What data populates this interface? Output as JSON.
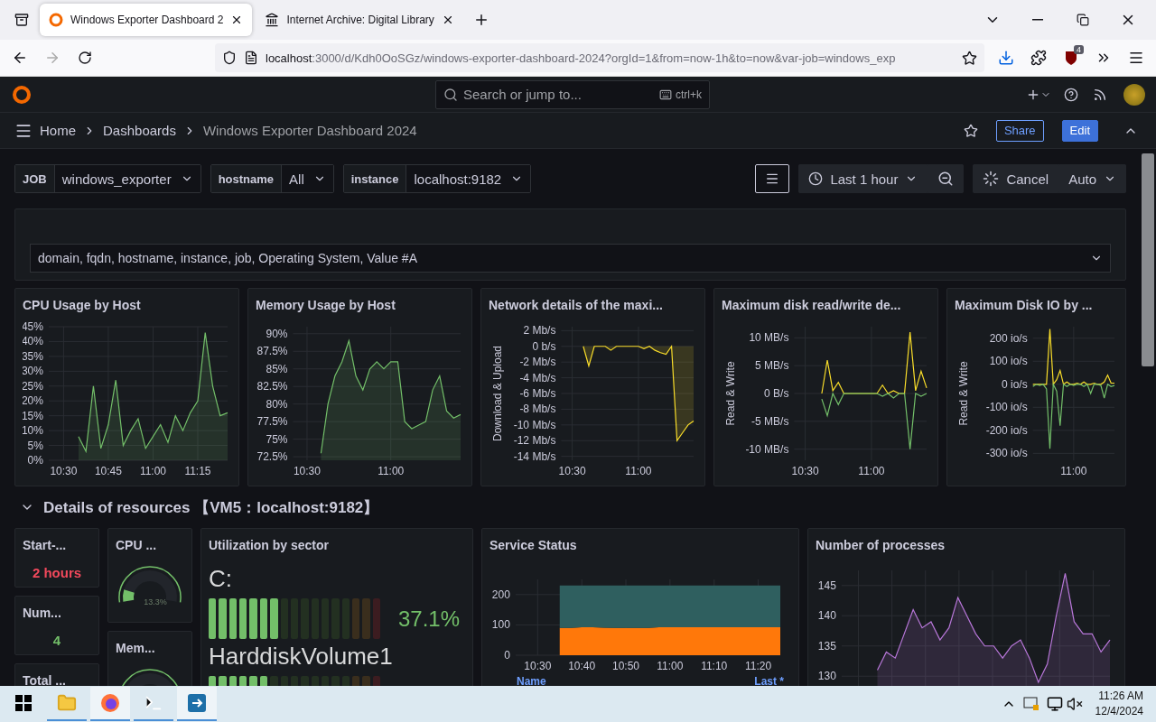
{
  "browser": {
    "tabs": [
      {
        "title": "Windows Exporter Dashboard 2",
        "selected": true
      },
      {
        "title": "Internet Archive: Digital Library",
        "selected": false
      }
    ],
    "address": {
      "host": "localhost",
      "path": ":3000/d/Kdh0OoSGz/windows-exporter-dashboard-2024?orgId=1&from=now-1h&to=now&var-job=windows_exp"
    },
    "extension_badge": "4"
  },
  "topbar": {
    "search_placeholder": "Search or jump to...",
    "shortcut": "ctrl+k"
  },
  "breadcrumbs": [
    "Home",
    "Dashboards",
    "Windows Exporter Dashboard 2024"
  ],
  "actions": [
    {
      "label": "Share",
      "kind": "secondary"
    },
    {
      "label": "Edit",
      "kind": "primary"
    }
  ],
  "variables": [
    {
      "label": "JOB",
      "value": "windows_exporter"
    },
    {
      "label": "hostname",
      "value": "All"
    },
    {
      "label": "instance",
      "value": "localhost:9182"
    }
  ],
  "time_range": "Last 1 hour",
  "cancel": "Cancel",
  "refresh": "Auto",
  "filter_select": {
    "value": "domain, fqdn, hostname, instance, job, Operating System, Value #A"
  },
  "panels": [
    {
      "title": "CPU Usage by Host",
      "chart_data": {
        "type": "area",
        "grid": true,
        "ylim": [
          0,
          45
        ],
        "categories": [
          null,
          null,
          "10:30",
          null,
          null,
          null,
          null,
          null,
          "10:45",
          null,
          null,
          null,
          null,
          null,
          "11:00",
          null,
          null,
          null,
          null,
          null,
          "11:15",
          null,
          null,
          null,
          null
        ],
        "yticks": [
          {
            "value": 45,
            "label": "45%"
          },
          {
            "value": 40,
            "label": "40%"
          },
          {
            "value": 35,
            "label": "35%"
          },
          {
            "value": 30,
            "label": "30%"
          },
          {
            "value": 25,
            "label": "25%"
          },
          {
            "value": 20,
            "label": "20%"
          },
          {
            "value": 15,
            "label": "15%"
          },
          {
            "value": 10,
            "label": "10%"
          },
          {
            "value": 5,
            "label": "5%"
          },
          {
            "value": 0,
            "label": "0%"
          }
        ],
        "series": [
          {
            "color": "#73bf69",
            "values": [
              null,
              null,
              null,
              null,
              8,
              3,
              25,
              4,
              12,
              27,
              5,
              10,
              14,
              4,
              8,
              12,
              6,
              15,
              10,
              16,
              20,
              43,
              25,
              15,
              16
            ]
          }
        ]
      }
    },
    {
      "title": "Memory Usage by Host",
      "chart_data": {
        "type": "area",
        "grid": true,
        "ylim": [
          72,
          91
        ],
        "categories": [
          null,
          null,
          "10:30",
          null,
          null,
          null,
          null,
          null,
          null,
          null,
          null,
          null,
          null,
          null,
          "11:00",
          null,
          null,
          null,
          null,
          null,
          null,
          null,
          null,
          null,
          null
        ],
        "yticks": [
          {
            "value": 90,
            "label": "90%"
          },
          {
            "value": 87.5,
            "label": "87.5%"
          },
          {
            "value": 85,
            "label": "85%"
          },
          {
            "value": 82.5,
            "label": "82.5%"
          },
          {
            "value": 80,
            "label": "80%"
          },
          {
            "value": 77.5,
            "label": "77.5%"
          },
          {
            "value": 75,
            "label": "75%"
          },
          {
            "value": 72.5,
            "label": "72.5%"
          }
        ],
        "series": [
          {
            "color": "#73bf69",
            "values": [
              null,
              null,
              null,
              null,
              73,
              80,
              84,
              86,
              89,
              84,
              82,
              85,
              86,
              85,
              86,
              86,
              77.5,
              76.5,
              77,
              77.5,
              82,
              84,
              79,
              78,
              78.5
            ]
          }
        ]
      }
    },
    {
      "title": "Network details of the maxi...",
      "chart_data": {
        "type": "area",
        "grid": true,
        "ylabel": "Download & Upload",
        "ylim": [
          -14.5,
          2.5
        ],
        "categories": [
          null,
          null,
          "10:30",
          null,
          null,
          null,
          null,
          null,
          null,
          null,
          null,
          null,
          null,
          null,
          "11:00",
          null,
          null,
          null,
          null,
          null,
          null,
          null,
          null,
          null,
          null
        ],
        "yticks": [
          {
            "value": 2,
            "label": "2 Mb/s"
          },
          {
            "value": 0,
            "label": "0 b/s"
          },
          {
            "value": -2,
            "label": "-2 Mb/s"
          },
          {
            "value": -4,
            "label": "-4 Mb/s"
          },
          {
            "value": -6,
            "label": "-6 Mb/s"
          },
          {
            "value": -8,
            "label": "-8 Mb/s"
          },
          {
            "value": -10,
            "label": "-10 Mb/s"
          },
          {
            "value": -12,
            "label": "-12 Mb/s"
          },
          {
            "value": -14,
            "label": "-14 Mb/s"
          }
        ],
        "series": [
          {
            "color": "#fade2a",
            "values": [
              null,
              null,
              null,
              null,
              0,
              -2.5,
              0,
              0,
              0,
              -0.5,
              0,
              0,
              0,
              0,
              0,
              -0.3,
              0,
              -0.5,
              -0.8,
              -1,
              0,
              -12,
              -11,
              -10,
              -9.5
            ]
          }
        ]
      }
    },
    {
      "title": "Maximum disk read/write de...",
      "chart_data": {
        "type": "line",
        "grid": true,
        "ylabel": "Read & Write",
        "ylim": [
          -12,
          12
        ],
        "categories": [
          null,
          null,
          "10:30",
          null,
          null,
          null,
          null,
          null,
          null,
          null,
          null,
          null,
          null,
          null,
          "11:00",
          null,
          null,
          null,
          null,
          null,
          null,
          null,
          null,
          null,
          null
        ],
        "yticks": [
          {
            "value": 10,
            "label": "10 MB/s"
          },
          {
            "value": 5,
            "label": "5 MB/s"
          },
          {
            "value": 0,
            "label": "0 B/s"
          },
          {
            "value": -5,
            "label": "-5 MB/s"
          },
          {
            "value": -10,
            "label": "-10 MB/s"
          }
        ],
        "series": [
          {
            "color": "#fade2a",
            "values": [
              null,
              null,
              null,
              null,
              null,
              0,
              6,
              0.5,
              2,
              0,
              0,
              0,
              0,
              0,
              0,
              0,
              1.5,
              0,
              0.5,
              0,
              0,
              11,
              0.5,
              4,
              1
            ]
          },
          {
            "color": "#73bf69",
            "values": [
              null,
              null,
              null,
              null,
              null,
              -1,
              -4,
              0,
              -2,
              0,
              0,
              0,
              0,
              0,
              0,
              0,
              -0.5,
              0,
              -0.8,
              0,
              0,
              -10,
              0,
              -0.5,
              0
            ]
          }
        ]
      }
    },
    {
      "title": "Maximum Disk IO by ...",
      "chart_data": {
        "type": "line",
        "grid": true,
        "ylabel": "Read & Write",
        "ylim": [
          -330,
          250
        ],
        "categories": [
          null,
          null,
          null,
          null,
          null,
          null,
          null,
          null,
          null,
          null,
          null,
          null,
          "11:00",
          null,
          null,
          null,
          null,
          null,
          null,
          null,
          null,
          null,
          null,
          null,
          null
        ],
        "yticks": [
          {
            "value": 200,
            "label": "200 io/s"
          },
          {
            "value": 100,
            "label": "100 io/s"
          },
          {
            "value": 0,
            "label": "0 io/s"
          },
          {
            "value": -100,
            "label": "-100 io/s"
          },
          {
            "value": -200,
            "label": "-200 io/s"
          },
          {
            "value": -300,
            "label": "-300 io/s"
          }
        ],
        "series": [
          {
            "color": "#fade2a",
            "values": [
              0,
              0,
              0,
              0,
              0,
              240,
              0,
              20,
              60,
              0,
              10,
              0,
              0,
              5,
              0,
              10,
              0,
              0,
              5,
              0,
              0,
              10,
              40,
              5,
              5
            ]
          },
          {
            "color": "#73bf69",
            "values": [
              -10,
              0,
              -5,
              0,
              -20,
              -280,
              0,
              -30,
              -180,
              0,
              -10,
              0,
              -5,
              0,
              0,
              -10,
              0,
              -40,
              0,
              0,
              -5,
              -60,
              0,
              -10,
              -5
            ]
          }
        ]
      }
    }
  ],
  "row": {
    "title": "Details of resources 【VM5：localhost:9182】",
    "expanded": true
  },
  "stats": [
    {
      "title": "Start-...",
      "value": "2 hours",
      "color": "#f2495c"
    },
    {
      "title": "Num...",
      "value": "4",
      "color": "#73bf69"
    },
    {
      "title": "Total ..."
    }
  ],
  "gauges": [
    {
      "title": "CPU ...",
      "value": "13.3%"
    },
    {
      "title": "Mem..."
    }
  ],
  "sector_panel": {
    "title": "Utilization by sector",
    "bars": [
      {
        "name": "C:",
        "level": 0.371,
        "value": "37.1%"
      },
      {
        "name": "HarddiskVolume1",
        "level": 0.35
      }
    ]
  },
  "service_panel": {
    "title": "Service Status",
    "legend": [
      "Name",
      "Last *"
    ],
    "chart_data": {
      "type": "area",
      "stacked": true,
      "grid": true,
      "ylim": [
        0,
        250
      ],
      "categories": [
        null,
        null,
        "10:30",
        null,
        null,
        null,
        "10:40",
        null,
        null,
        null,
        "10:50",
        null,
        null,
        null,
        "11:00",
        null,
        null,
        null,
        "11:10",
        null,
        null,
        null,
        "11:20",
        null,
        null
      ],
      "yticks": [
        0,
        100,
        200
      ],
      "series": [
        {
          "color": "#ff780a",
          "values": [
            null,
            null,
            null,
            null,
            90,
            90,
            92,
            92,
            91,
            90,
            90,
            90,
            90,
            92,
            92,
            92,
            92,
            92,
            92,
            92,
            92,
            92,
            92,
            92,
            92
          ]
        },
        {
          "color": "#2f5f5f",
          "values": [
            null,
            null,
            null,
            null,
            140,
            140,
            138,
            138,
            139,
            140,
            140,
            140,
            140,
            138,
            138,
            138,
            138,
            138,
            138,
            138,
            138,
            138,
            138,
            138,
            138
          ]
        }
      ]
    }
  },
  "process_panel": {
    "title": "Number of processes",
    "chart_data": {
      "type": "area",
      "grid": true,
      "ylim": [
        127.5,
        147.5
      ],
      "categories": [
        null,
        null,
        null,
        null,
        null,
        null,
        null,
        null,
        null,
        null,
        null,
        null,
        null,
        null,
        null,
        null,
        null,
        null,
        null,
        null,
        null,
        null,
        null,
        null,
        null,
        null,
        null,
        null,
        null,
        null,
        null
      ],
      "yticks": [
        145,
        140,
        135,
        130
      ],
      "series": [
        {
          "color": "#b877d9",
          "values": [
            null,
            null,
            null,
            null,
            131,
            134,
            133,
            137,
            141,
            138,
            139,
            136,
            138,
            143,
            140,
            137,
            135,
            135,
            133,
            135,
            136,
            133,
            129,
            132,
            140,
            147,
            139,
            137,
            137,
            134,
            136
          ]
        }
      ]
    }
  },
  "taskbar": {
    "time": "11:26 AM",
    "date": "12/4/2024"
  }
}
